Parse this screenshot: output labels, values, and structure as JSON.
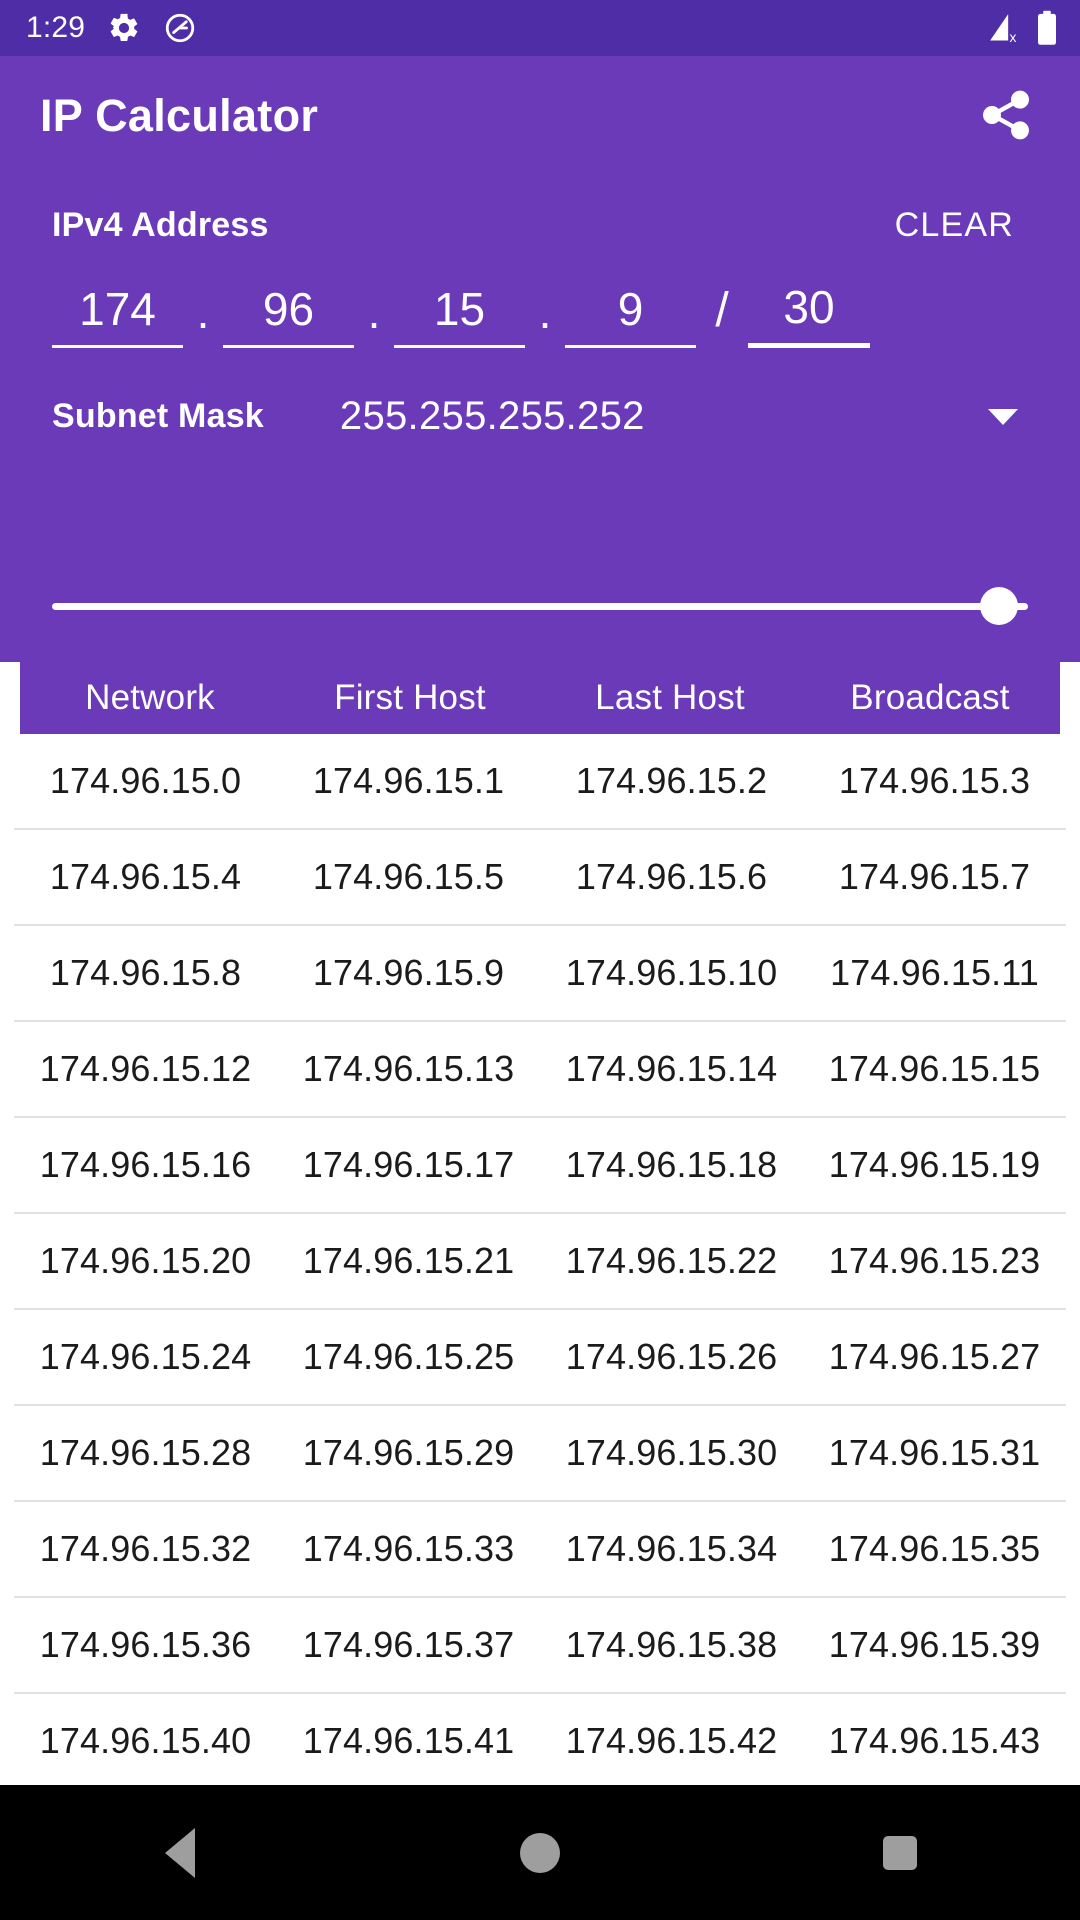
{
  "status_bar": {
    "time": "1:29",
    "left_icons": [
      "gear-icon",
      "dnd-icon"
    ],
    "right_icons": [
      "cellular-off-icon",
      "battery-full-icon"
    ],
    "background_color": "#4E2DA6"
  },
  "app_bar": {
    "title": "IP Calculator",
    "share_icon": "share-icon",
    "background_color": "#6A3AB8"
  },
  "input_panel": {
    "ipv4_label": "IPv4 Address",
    "clear_label": "CLEAR",
    "octets": [
      "174",
      "96",
      "15",
      "9"
    ],
    "dot": ".",
    "slash": "/",
    "cidr": "30",
    "subnet_label": "Subnet Mask",
    "subnet_value": "255.255.255.252",
    "dropdown_icon": "chevron-down-icon",
    "slider": {
      "value": 30,
      "min": 0,
      "max": 32,
      "percent": 97
    }
  },
  "table": {
    "headers": [
      "Network",
      "First Host",
      "Last Host",
      "Broadcast"
    ],
    "rows": [
      [
        "174.96.15.0",
        "174.96.15.1",
        "174.96.15.2",
        "174.96.15.3"
      ],
      [
        "174.96.15.4",
        "174.96.15.5",
        "174.96.15.6",
        "174.96.15.7"
      ],
      [
        "174.96.15.8",
        "174.96.15.9",
        "174.96.15.10",
        "174.96.15.11"
      ],
      [
        "174.96.15.12",
        "174.96.15.13",
        "174.96.15.14",
        "174.96.15.15"
      ],
      [
        "174.96.15.16",
        "174.96.15.17",
        "174.96.15.18",
        "174.96.15.19"
      ],
      [
        "174.96.15.20",
        "174.96.15.21",
        "174.96.15.22",
        "174.96.15.23"
      ],
      [
        "174.96.15.24",
        "174.96.15.25",
        "174.96.15.26",
        "174.96.15.27"
      ],
      [
        "174.96.15.28",
        "174.96.15.29",
        "174.96.15.30",
        "174.96.15.31"
      ],
      [
        "174.96.15.32",
        "174.96.15.33",
        "174.96.15.34",
        "174.96.15.35"
      ],
      [
        "174.96.15.36",
        "174.96.15.37",
        "174.96.15.38",
        "174.96.15.39"
      ],
      [
        "174.96.15.40",
        "174.96.15.41",
        "174.96.15.42",
        "174.96.15.43"
      ]
    ]
  },
  "nav_bar": {
    "back_icon": "back-triangle-icon",
    "home_icon": "home-circle-icon",
    "recent_icon": "recents-square-icon"
  }
}
